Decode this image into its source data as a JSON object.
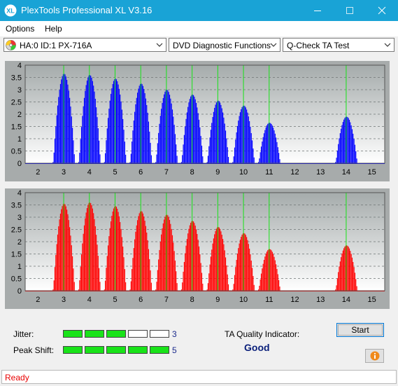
{
  "window": {
    "title": "PlexTools Professional XL V3.16",
    "icon_label": "XL",
    "controls": [
      "minimize-icon",
      "maximize-icon",
      "close-icon"
    ]
  },
  "menu": {
    "items": [
      "Options",
      "Help"
    ]
  },
  "toolbar": {
    "drive": "HA:0 ID:1  PX-716A",
    "function": "DVD Diagnostic Functions",
    "test": "Q-Check TA Test"
  },
  "chart_data": [
    {
      "type": "bar",
      "series": [
        {
          "color": "#0000ff"
        }
      ],
      "ylim": [
        0,
        4
      ],
      "yticks": [
        "0",
        "0.5",
        "1",
        "1.5",
        "2",
        "2.5",
        "3",
        "3.5",
        "4"
      ],
      "xlim": [
        1.5,
        15.5
      ],
      "xticks": [
        "2",
        "3",
        "4",
        "5",
        "6",
        "7",
        "8",
        "9",
        "10",
        "11",
        "12",
        "13",
        "14",
        "15"
      ],
      "reference_lines_x": [
        3,
        4,
        5,
        6,
        7,
        8,
        9,
        10,
        11,
        14
      ],
      "peaks": [
        {
          "x": 3,
          "y": 3.65
        },
        {
          "x": 4,
          "y": 3.6
        },
        {
          "x": 5,
          "y": 3.45
        },
        {
          "x": 6,
          "y": 3.25
        },
        {
          "x": 7,
          "y": 3.0
        },
        {
          "x": 8,
          "y": 2.8
        },
        {
          "x": 9,
          "y": 2.55
        },
        {
          "x": 10,
          "y": 2.35
        },
        {
          "x": 11,
          "y": 1.65
        },
        {
          "x": 14,
          "y": 1.9
        }
      ],
      "grid": true
    },
    {
      "type": "bar",
      "series": [
        {
          "color": "#ff0000"
        }
      ],
      "ylim": [
        0,
        4
      ],
      "yticks": [
        "0",
        "0.5",
        "1",
        "1.5",
        "2",
        "2.5",
        "3",
        "3.5",
        "4"
      ],
      "xlim": [
        1.5,
        15.5
      ],
      "xticks": [
        "2",
        "3",
        "4",
        "5",
        "6",
        "7",
        "8",
        "9",
        "10",
        "11",
        "12",
        "13",
        "14",
        "15"
      ],
      "reference_lines_x": [
        3,
        4,
        5,
        6,
        7,
        8,
        9,
        10,
        11,
        14
      ],
      "peaks": [
        {
          "x": 3,
          "y": 3.55
        },
        {
          "x": 4,
          "y": 3.6
        },
        {
          "x": 5,
          "y": 3.45
        },
        {
          "x": 6,
          "y": 3.25
        },
        {
          "x": 7,
          "y": 3.1
        },
        {
          "x": 8,
          "y": 2.85
        },
        {
          "x": 9,
          "y": 2.6
        },
        {
          "x": 10,
          "y": 2.35
        },
        {
          "x": 11,
          "y": 1.7
        },
        {
          "x": 14,
          "y": 1.85
        }
      ],
      "grid": true
    }
  ],
  "results": {
    "jitter_label": "Jitter:",
    "jitter_value": "3",
    "jitter_level": 3,
    "peak_shift_label": "Peak Shift:",
    "peak_shift_value": "5",
    "peak_shift_level": 5,
    "max_level": 5,
    "ta_label": "TA Quality Indicator:",
    "ta_value": "Good",
    "ta_color": "#0a1f7a"
  },
  "buttons": {
    "start": "Start"
  },
  "status": {
    "text": "Ready",
    "color": "#e80000"
  }
}
